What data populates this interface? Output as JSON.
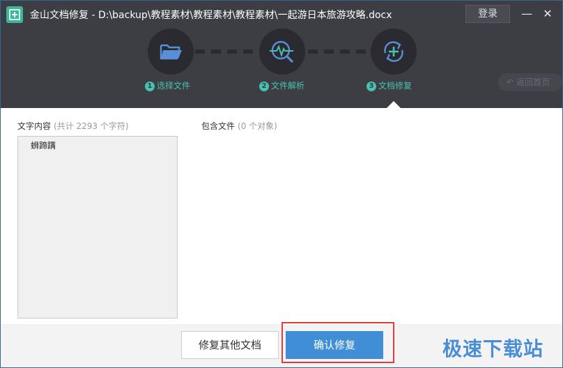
{
  "window": {
    "title": "金山文档修复 - D:\\backup\\教程素材\\教程素材\\教程素材\\一起游日本旅游攻略.docx",
    "login_label": "登录",
    "minimize_label": "—",
    "close_label": "✕"
  },
  "steps": [
    {
      "num": "1",
      "label": "选择文件",
      "icon": "folder-icon"
    },
    {
      "num": "2",
      "label": "文件解析",
      "icon": "analyze-icon"
    },
    {
      "num": "3",
      "label": "文档修复",
      "icon": "repair-icon"
    }
  ],
  "back_home_label": "返回首页",
  "text_content": {
    "title": "文字内容",
    "subtitle": "(共计 2293 个字符)",
    "body": "蛳蹄蹒"
  },
  "included_files": {
    "title": "包含文件",
    "subtitle": "(0 个对象)"
  },
  "footer": {
    "repair_other_label": "修复其他文档",
    "confirm_label": "确认修复"
  },
  "watermark": "极速下载站",
  "colors": {
    "header_bg": "#3d3d44",
    "accent_teal": "#48c2b0",
    "primary_blue": "#3f8ed6",
    "highlight_red": "#e23b3b"
  }
}
